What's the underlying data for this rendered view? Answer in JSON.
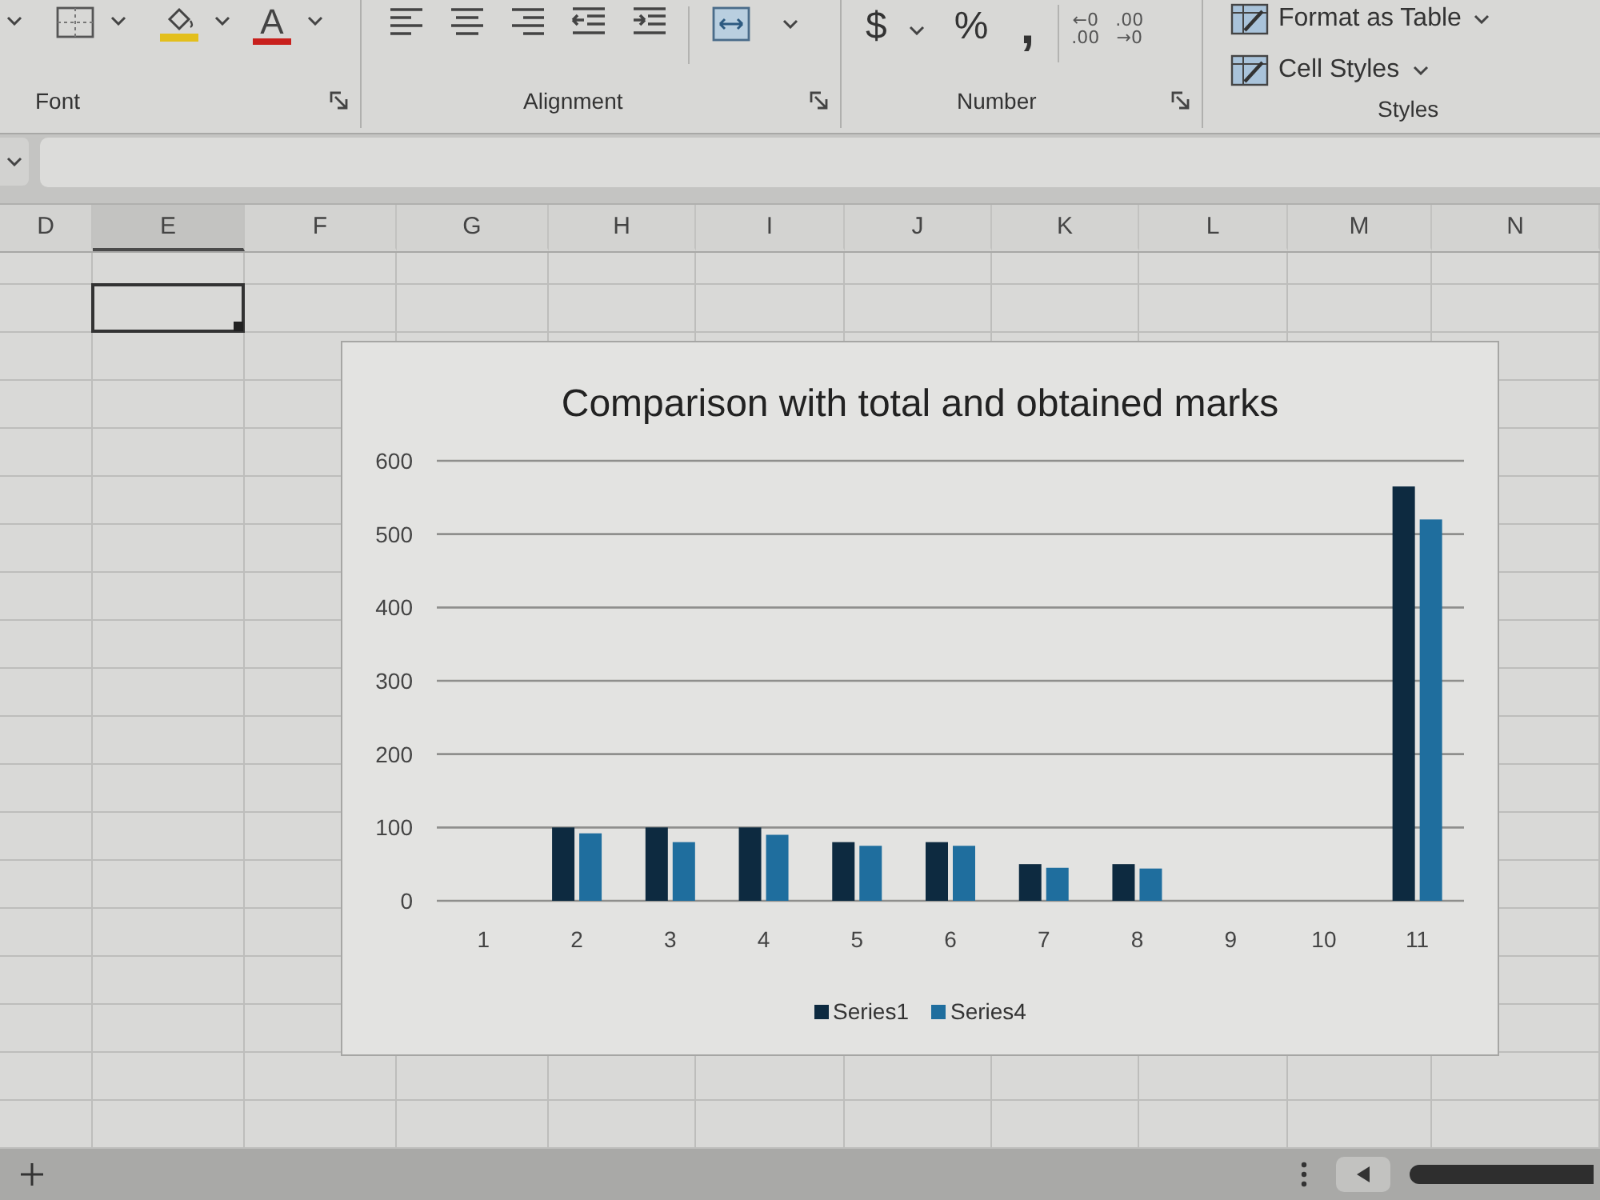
{
  "ribbon": {
    "font_group": {
      "label": "Font",
      "font_color": {
        "glyph": "A"
      }
    },
    "alignment_group": {
      "label": "Alignment"
    },
    "number_group": {
      "label": "Number",
      "format_buttons": [
        {
          "glyph": "$",
          "dropdown": true
        },
        {
          "glyph": "%",
          "dropdown": false
        },
        {
          "glyph": ",",
          "dropdown": false
        }
      ],
      "decimal_buttons": [
        {
          "top": "←0",
          "bottom": ".00"
        },
        {
          "top": ".00",
          "bottom": "→0"
        }
      ]
    },
    "styles_group": {
      "label": "Styles",
      "buttons": [
        "Format as Table",
        "Cell Styles"
      ]
    }
  },
  "columns": [
    {
      "label": "D",
      "selected": false
    },
    {
      "label": "E",
      "selected": true
    },
    {
      "label": "F",
      "selected": false
    },
    {
      "label": "G",
      "selected": false
    },
    {
      "label": "H",
      "selected": false
    },
    {
      "label": "I",
      "selected": false
    },
    {
      "label": "J",
      "selected": false
    },
    {
      "label": "K",
      "selected": false
    },
    {
      "label": "L",
      "selected": false
    },
    {
      "label": "M",
      "selected": false
    },
    {
      "label": "N",
      "selected": false
    }
  ],
  "chart": {
    "chart_data": {
      "type": "bar",
      "title": "Comparison with total and obtained marks",
      "categories": [
        "1",
        "2",
        "3",
        "4",
        "5",
        "6",
        "7",
        "8",
        "9",
        "10",
        "11"
      ],
      "series": [
        {
          "name": "Series1",
          "color": "#0d2a40",
          "values": [
            null,
            100,
            100,
            100,
            80,
            80,
            50,
            50,
            null,
            null,
            565
          ]
        },
        {
          "name": "Series4",
          "color": "#1f6e9e",
          "values": [
            null,
            92,
            80,
            90,
            75,
            75,
            45,
            44,
            null,
            null,
            520
          ]
        }
      ],
      "ylim": [
        0,
        600
      ],
      "yticks": [
        0,
        100,
        200,
        300,
        400,
        500,
        600
      ],
      "grid": true,
      "legend": "bottom"
    }
  }
}
